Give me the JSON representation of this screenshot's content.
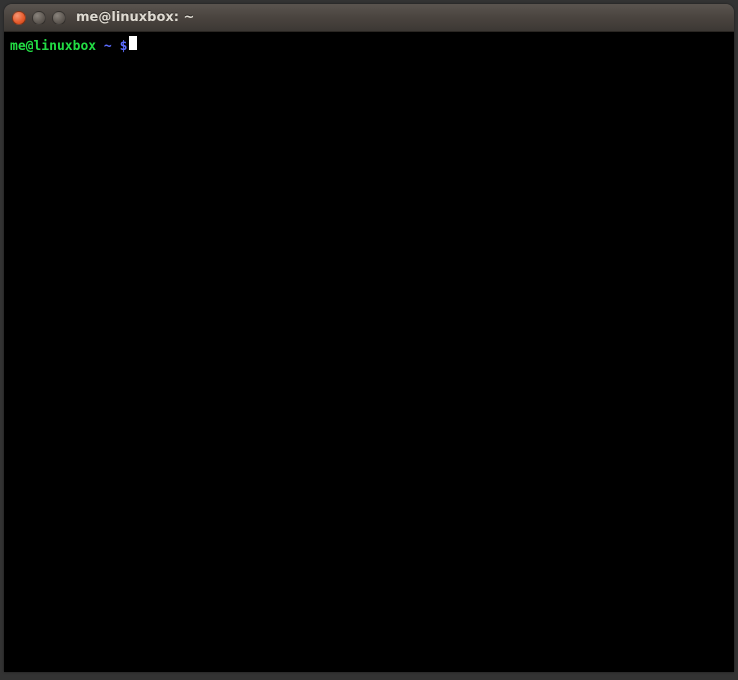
{
  "window": {
    "title": "me@linuxbox: ~"
  },
  "terminal": {
    "prompt_user_host": "me@linuxbox",
    "prompt_separator": " ",
    "prompt_path": "~ $",
    "input": ""
  }
}
